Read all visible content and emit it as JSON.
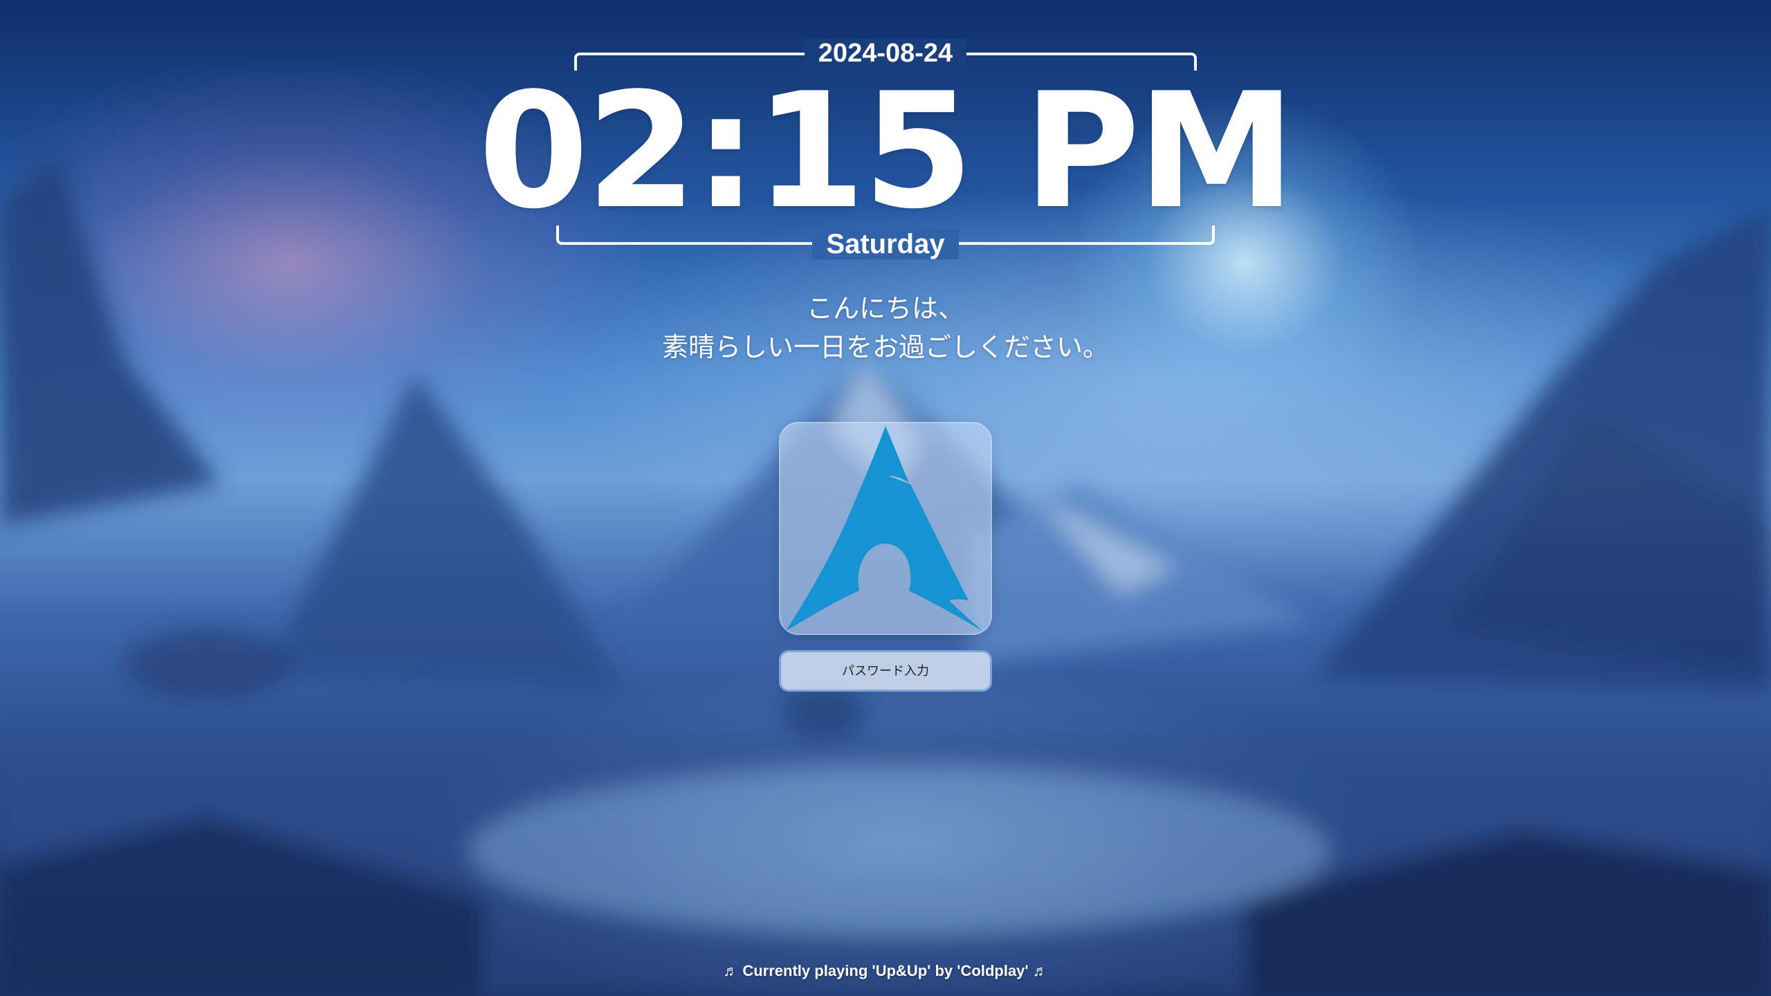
{
  "lockscreen": {
    "date": "2024-08-24",
    "time": "02:15 PM",
    "day": "Saturday",
    "greeting_line1": "こんにちは、",
    "greeting_line2": "素晴らしい一日をお過ごしください。",
    "password_placeholder": "パスワード入力",
    "now_playing": "♬ Currently playing 'Up&Up' by 'Coldplay' ♬"
  },
  "avatar": {
    "icon": "arch-linux-logo-icon",
    "color": "#1793d1"
  },
  "colors": {
    "text": "#ffffff",
    "accent": "#1793d1"
  }
}
